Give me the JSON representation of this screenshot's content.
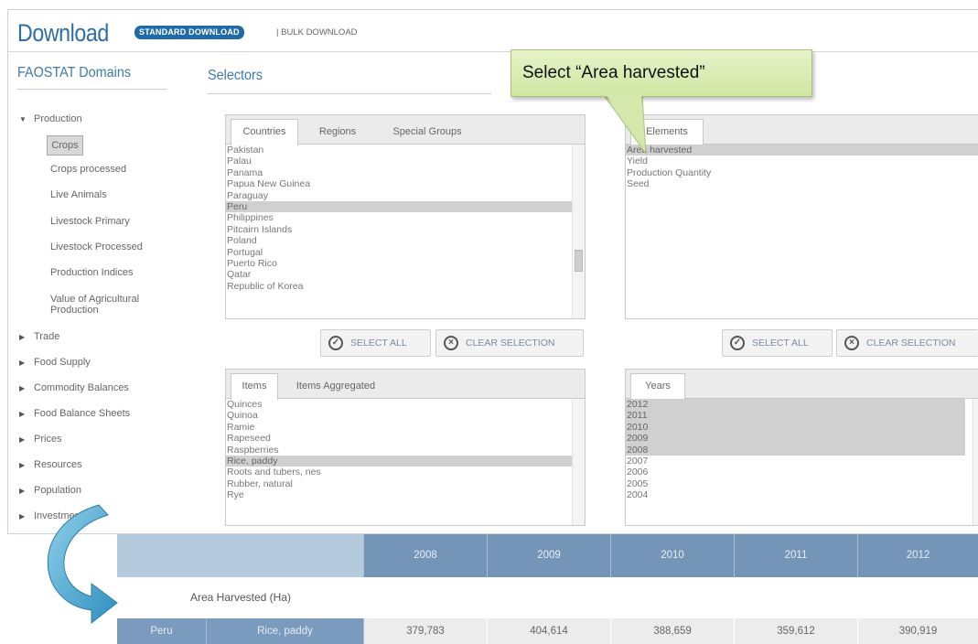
{
  "header": {
    "title": "Download",
    "standard_label": "STANDARD DOWNLOAD",
    "bulk_label": "| BULK DOWNLOAD"
  },
  "sidebar": {
    "title": "FAOSTAT Domains",
    "production_label": "Production",
    "sub_items": [
      "Crops",
      "Crops processed",
      "Live Animals",
      "Livestock Primary",
      "Livestock Processed",
      "Production Indices",
      "Value of Agricultural",
      "Production"
    ],
    "groups": [
      "Trade",
      "Food Supply",
      "Commodity Balances",
      "Food Balance Sheets",
      "Prices",
      "Resources",
      "Population",
      "Investment"
    ]
  },
  "selectors": {
    "title": "Selectors",
    "countries": {
      "tabs": [
        "Countries",
        "Regions",
        "Special Groups"
      ],
      "items": [
        "Pakistan",
        "Palau",
        "Panama",
        "Papua New Guinea",
        "Paraguay",
        "Peru",
        "Philippines",
        "Pitcairn Islands",
        "Poland",
        "Portugal",
        "Puerto Rico",
        "Qatar",
        "Republic of Korea"
      ],
      "selected": "Peru"
    },
    "elements": {
      "tabs": [
        "Elements"
      ],
      "items": [
        "Area harvested",
        "Yield",
        "Production Quantity",
        "Seed"
      ],
      "selected": "Area harvested"
    },
    "items": {
      "tabs": [
        "Items",
        "Items Aggregated"
      ],
      "items": [
        "Quinces",
        "Quinoa",
        "Ramie",
        "Rapeseed",
        "Raspberries",
        "Rice, paddy",
        "Roots and tubers, nes",
        "Rubber, natural",
        "Rye"
      ],
      "selected": "Rice, paddy"
    },
    "years": {
      "tabs": [
        "Years"
      ],
      "items": [
        "2012",
        "2011",
        "2010",
        "2009",
        "2008",
        "2007",
        "2006",
        "2005",
        "2004"
      ],
      "selected": [
        "2012",
        "2011",
        "2010",
        "2009",
        "2008"
      ]
    },
    "select_all_label": "SELECT ALL",
    "clear_label": "CLEAR SELECTION"
  },
  "callout": {
    "text": "Select  “Area harvested”"
  },
  "result_table": {
    "years": [
      "2008",
      "2009",
      "2010",
      "2011",
      "2012"
    ],
    "element_label": "Area Harvested (Ha)",
    "country": "Peru",
    "item": "Rice, paddy",
    "values": [
      "379,783",
      "404,614",
      "388,659",
      "359,612",
      "390,919"
    ]
  },
  "colors": {
    "accent": "#2d6ea6",
    "table_header": "#7595b8",
    "callout_fill": "#d8ebb3",
    "arrow": "#4aa3c8"
  }
}
